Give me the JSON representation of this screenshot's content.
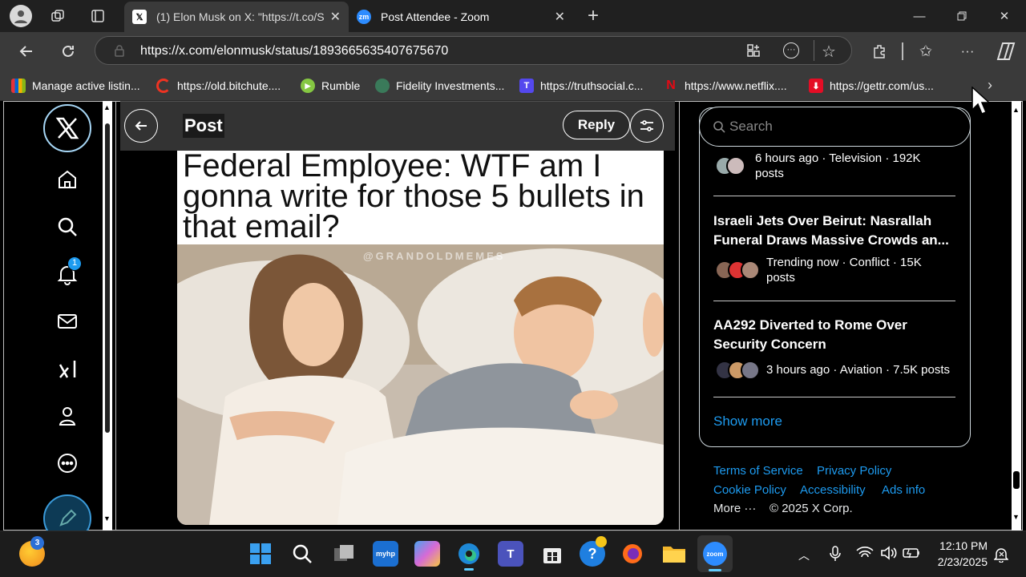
{
  "browser": {
    "tabs": [
      {
        "label": "(1) Elon Musk on X: \"https://t.co/S",
        "favicon": "X",
        "active": true
      },
      {
        "label": "Post Attendee - Zoom",
        "favicon": "zm",
        "active": false
      }
    ],
    "url": "https://x.com/elonmusk/status/1893665635407675670",
    "bookmarks": [
      {
        "label": "Manage active listin...",
        "icon": "ebay-icon"
      },
      {
        "label": "https://old.bitchute....",
        "icon": "bitchute-icon"
      },
      {
        "label": "Rumble",
        "icon": "rumble-icon"
      },
      {
        "label": "Fidelity Investments...",
        "icon": "fidelity-icon"
      },
      {
        "label": "https://truthsocial.c...",
        "icon": "truthsocial-icon"
      },
      {
        "label": "https://www.netflix....",
        "icon": "netflix-icon"
      },
      {
        "label": "https://gettr.com/us...",
        "icon": "gettr-icon"
      }
    ]
  },
  "x": {
    "header": {
      "title": "Post",
      "reply_label": "Reply"
    },
    "notifications_badge": "1",
    "meme": {
      "caption": "Federal Employee: WTF am I gonna write for those 5 bullets in that email?",
      "watermark": "@GRANDOLDMEMES"
    },
    "search_placeholder": "Search",
    "trends": [
      {
        "title": "",
        "meta": "6 hours ago · Television · 192K posts"
      },
      {
        "title": "Israeli Jets Over Beirut: Nasrallah Funeral Draws Massive Crowds an...",
        "meta": "Trending now · Conflict · 15K posts"
      },
      {
        "title": "AA292 Diverted to Rome Over Security Concern",
        "meta": "3 hours ago · Aviation · 7.5K posts"
      }
    ],
    "show_more": "Show more",
    "footer": {
      "terms": "Terms of Service",
      "privacy": "Privacy Policy",
      "cookie": "Cookie Policy",
      "accessibility": "Accessibility",
      "ads": "Ads info",
      "more": "More ···",
      "copyright": "© 2025 X Corp."
    }
  },
  "taskbar": {
    "weather_badge": "3",
    "time": "12:10 PM",
    "date": "2/23/2025"
  },
  "colors": {
    "accent": "#1d9bf0",
    "bg": "#000000",
    "chrome": "#3a3a3a"
  }
}
